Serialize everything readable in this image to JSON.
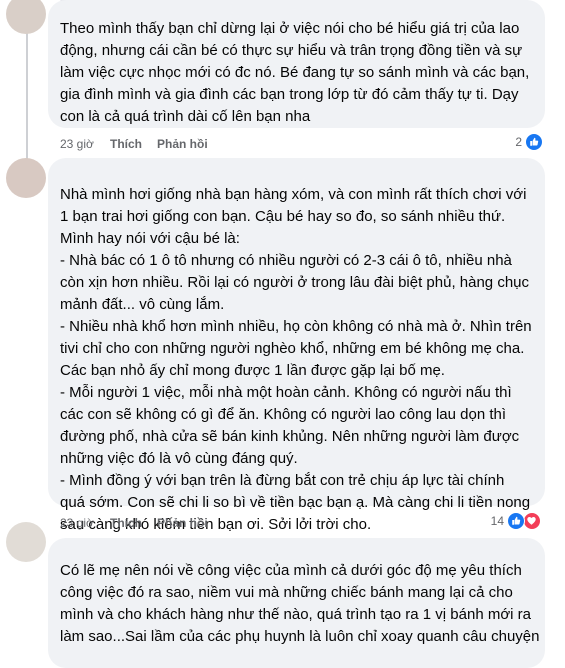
{
  "colors": {
    "like": "#1877f2",
    "love": "#f33e58",
    "bubble": "#f0f2f5",
    "meta": "#65676b"
  },
  "comments": [
    {
      "lines": [
        "Theo mình thấy bạn chỉ dừng lại ở việc nói cho bé hiểu giá trị của lao",
        "động, nhưng cái cần bé có thực sự hiểu và trân trọng đồng tiền và sự",
        "làm việc cực nhọc mới có đc nó. Bé đang tự so sánh mình và các bạn,",
        "gia đình mình và gia đình các bạn trong lớp từ đó cảm thấy tự ti. Dạy",
        "con là cả quá trình dài cố lên bạn nha"
      ],
      "time": "23 giờ",
      "like": "Thích",
      "reply": "Phản hồi",
      "reaction_count": "2",
      "reaction_icons": [
        "like-icon"
      ]
    },
    {
      "lines": [
        "Nhà mình hơi giống nhà bạn hàng xóm, và con mình rất thích chơi với",
        "1 bạn trai hơi giống con bạn. Cậu bé hay so đo, so sánh nhiều thứ.",
        "Mình hay nói với cậu bé là:",
        "- Nhà bác có 1 ô tô nhưng có nhiều người có 2-3 cái ô tô, nhiều nhà",
        "còn xịn hơn nhiều. Rồi lại có người ở trong lâu đài biệt phủ, hàng chục",
        "mảnh đất... vô cùng lắm.",
        "- Nhiều nhà khổ hơn mình nhiều, họ còn không có nhà mà ở. Nhìn trên",
        "tivi chỉ cho con những người nghèo khổ, những em bé không mẹ cha.",
        "Các bạn nhỏ ấy chỉ mong được 1 lần được gặp lại bố mẹ.",
        "- Mỗi người 1 việc, mỗi nhà một hoàn cảnh. Không có người nấu thì",
        "các con sẽ không có gì để ăn. Không có người lao công lau dọn thì",
        "đường phố, nhà cửa sẽ bán kinh khủng. Nên những người làm được",
        "những việc đó là vô cùng đáng quý.",
        "- Mình đồng ý với bạn trên là đừng bắt con trẻ chịu áp lực tài chính",
        "quá sớm. Con sẽ chi li so bì về tiền bạc bạn ạ. Mà càng chi li tiền nong",
        "sau càng khó kiếm tiền bạn ơi. Sởi lởi trời cho."
      ],
      "time": "23 giờ",
      "like": "Thích",
      "reply": "Phản hồi",
      "reaction_count": "14",
      "reaction_icons": [
        "like-icon",
        "heart-icon"
      ]
    },
    {
      "lines": [
        "Có lẽ mẹ nên nói về công việc của mình cả dưới góc độ mẹ yêu thích",
        "công việc đó ra sao, niềm vui mà những chiếc bánh mang lại cả cho",
        "mình và cho khách hàng như thế nào, quá trình tạo ra 1 vị bánh mới ra",
        "làm sao...Sai lầm của các phụ huynh là luôn chỉ xoay quanh câu chuyện"
      ]
    }
  ]
}
